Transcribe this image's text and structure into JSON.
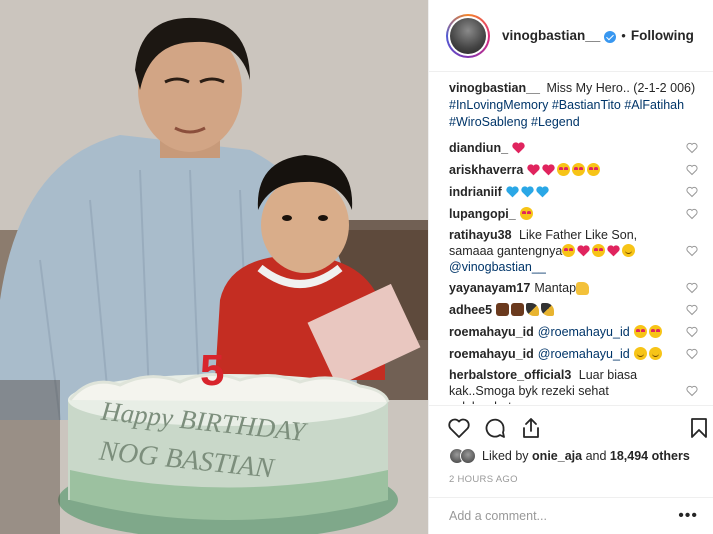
{
  "post": {
    "image_alt": "Vintage photo of a father and young son behind a birthday cake",
    "cake_text_line1": "Happy BIRTHDAY",
    "cake_text_line2": "NOG BASTIAN",
    "candle_number": "5"
  },
  "header": {
    "username": "vinogbastian__",
    "dot": "•",
    "follow_label": "Following"
  },
  "caption": {
    "username": "vinogbastian__",
    "text": "Miss My Hero.. (2-1-2 006)",
    "hashtags": "#InLovingMemory #BastianTito #AlFatihah #WiroSableng #Legend"
  },
  "comments": [
    {
      "user": "diandiun_",
      "text": "",
      "emoji": [
        "heart-red"
      ]
    },
    {
      "user": "ariskhaverra",
      "text": "",
      "emoji": [
        "heart-red",
        "heart-red",
        "heart-eyes",
        "heart-eyes",
        "heart-eyes"
      ]
    },
    {
      "user": "indrianiif",
      "text": "",
      "emoji": [
        "heart-blue",
        "heart-blue",
        "heart-blue"
      ]
    },
    {
      "user": "lupangopi_",
      "text": "",
      "emoji": [
        "heart-eyes"
      ]
    },
    {
      "user": "ratihayu38",
      "text": "Like Father Like Son, samaaa gantengnya",
      "emoji": [
        "heart-eyes",
        "heart-red",
        "heart-eyes",
        "heart-red",
        "smile"
      ],
      "mention": "@vinogbastian__"
    },
    {
      "user": "yayanayam17",
      "text": "Mantap",
      "emoji": [
        "thumbs-up"
      ]
    },
    {
      "user": "adhee5",
      "text": "",
      "emoji": [
        "chocolate",
        "chocolate",
        "rocket",
        "rocket"
      ]
    },
    {
      "user": "roemahayu_id",
      "text": "",
      "emoji": [
        "heart-eyes",
        "heart-eyes"
      ],
      "mention": "@roemahayu_id"
    },
    {
      "user": "roemahayu_id",
      "text": "",
      "emoji": [
        "smile",
        "smile"
      ],
      "mention": "@roemahayu_id"
    },
    {
      "user": "herbalstore_official3",
      "text": "Luar biasa kak..Smoga byk rezeki sehat selalu.whatsapp:",
      "emoji": []
    }
  ],
  "likes": {
    "prefix": "Liked by",
    "first_user": "onie_aja",
    "middle": "and",
    "count": "18,494 others"
  },
  "timestamp": "2 HOURS AGO",
  "add_comment": {
    "placeholder": "Add a comment...",
    "more": "•••"
  },
  "colors": {
    "accent_blue": "#3897f0",
    "hashtag": "#003569",
    "border": "#efefef",
    "muted": "#999999"
  }
}
